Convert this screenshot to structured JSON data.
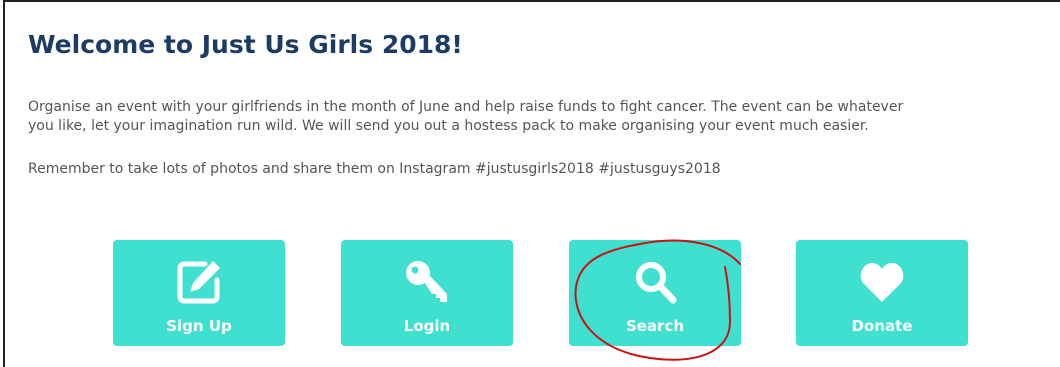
{
  "page": {
    "title": "Welcome to Just Us Girls 2018!",
    "intro_line1": "Organise an event with your girlfriends in the month of June and help raise funds to fight cancer. The event can be whatever",
    "intro_line2": "you like, let your imagination run wild. We will send you out a hostess pack to make organising your event much easier.",
    "reminder": "Remember to take lots of photos and share them on Instagram #justusgirls2018 #justusguys2018"
  },
  "tiles": [
    {
      "label": "Sign Up",
      "icon": "edit-icon"
    },
    {
      "label": "Login",
      "icon": "key-icon"
    },
    {
      "label": "Search",
      "icon": "search-icon"
    },
    {
      "label": "Donate",
      "icon": "heart-icon"
    }
  ],
  "colors": {
    "tile_bg": "#40e0d0",
    "title": "#1c3c63",
    "body_text": "#555555",
    "annotation": "#cc1111"
  }
}
